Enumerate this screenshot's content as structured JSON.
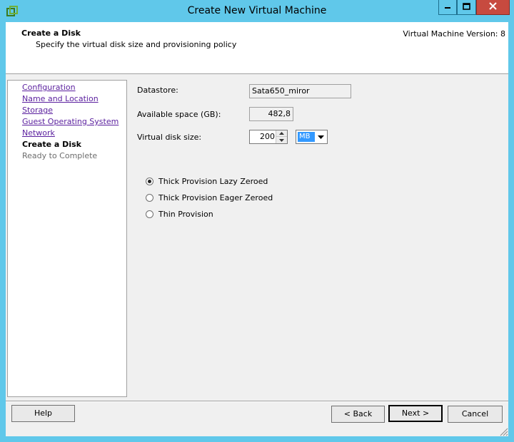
{
  "window": {
    "title": "Create New Virtual Machine"
  },
  "header": {
    "title": "Create a Disk",
    "subtitle": "Specify the virtual disk size and provisioning policy",
    "version": "Virtual Machine Version: 8"
  },
  "steps": [
    {
      "label": "Configuration",
      "state": "link"
    },
    {
      "label": "Name and Location",
      "state": "link"
    },
    {
      "label": "Storage",
      "state": "link"
    },
    {
      "label": "Guest Operating System",
      "state": "link"
    },
    {
      "label": "Network",
      "state": "link"
    },
    {
      "label": "Create a Disk",
      "state": "current"
    },
    {
      "label": "Ready to Complete",
      "state": "future"
    }
  ],
  "form": {
    "datastore_label": "Datastore:",
    "datastore_value": "Sata650_miror",
    "available_label": "Available space (GB):",
    "available_value": "482,8",
    "disk_size_label": "Virtual disk size:",
    "disk_size_value": "200",
    "disk_unit": "MB",
    "provisioning": [
      {
        "label": "Thick Provision Lazy Zeroed",
        "selected": true
      },
      {
        "label": "Thick Provision Eager Zeroed",
        "selected": false
      },
      {
        "label": "Thin Provision",
        "selected": false
      }
    ]
  },
  "buttons": {
    "help": "Help",
    "back": "< Back",
    "next": "Next >",
    "cancel": "Cancel"
  },
  "colors": {
    "titlebar": "#60c8ea",
    "close_button": "#c74a3f",
    "link": "#5a1f9e",
    "selection": "#3399ff"
  }
}
